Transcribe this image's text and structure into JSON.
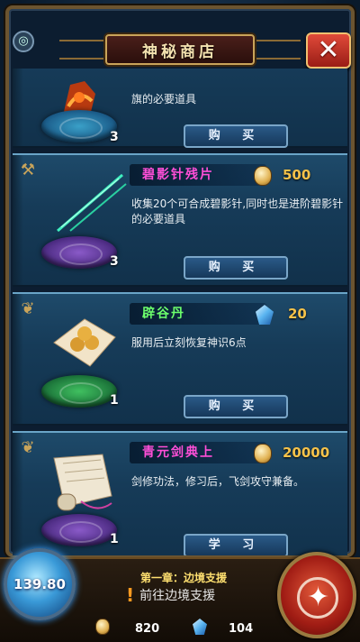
{
  "window": {
    "title": "神秘商店"
  },
  "close_label": "✕",
  "items": [
    {
      "name": "",
      "desc": "旗的必要道具",
      "qty": "3",
      "price": "",
      "currency": "",
      "button": "购 买"
    },
    {
      "name": "碧影针残片",
      "desc": "收集20个可合成碧影针,同时也是进阶碧影针的必要道具",
      "qty": "3",
      "price": "500",
      "currency": "coin",
      "button": "购 买"
    },
    {
      "name": "辟谷丹",
      "desc": "服用后立刻恢复神识6点",
      "qty": "1",
      "price": "20",
      "currency": "gem",
      "button": "购 买"
    },
    {
      "name": "青元剑典上",
      "desc": "剑修功法，修习后，飞剑攻守兼备。",
      "qty": "1",
      "price": "20000",
      "currency": "coin",
      "button": "学 习"
    }
  ],
  "colors": {
    "name_pink": "#ff4fd8",
    "name_green": "#6cff6c",
    "price_gold": "#f5c24a"
  },
  "bottom": {
    "orb_value": "139.80",
    "chapter": "第一章：边境支援",
    "quest": "前往边境支援",
    "coins": "820",
    "gems": "104"
  }
}
